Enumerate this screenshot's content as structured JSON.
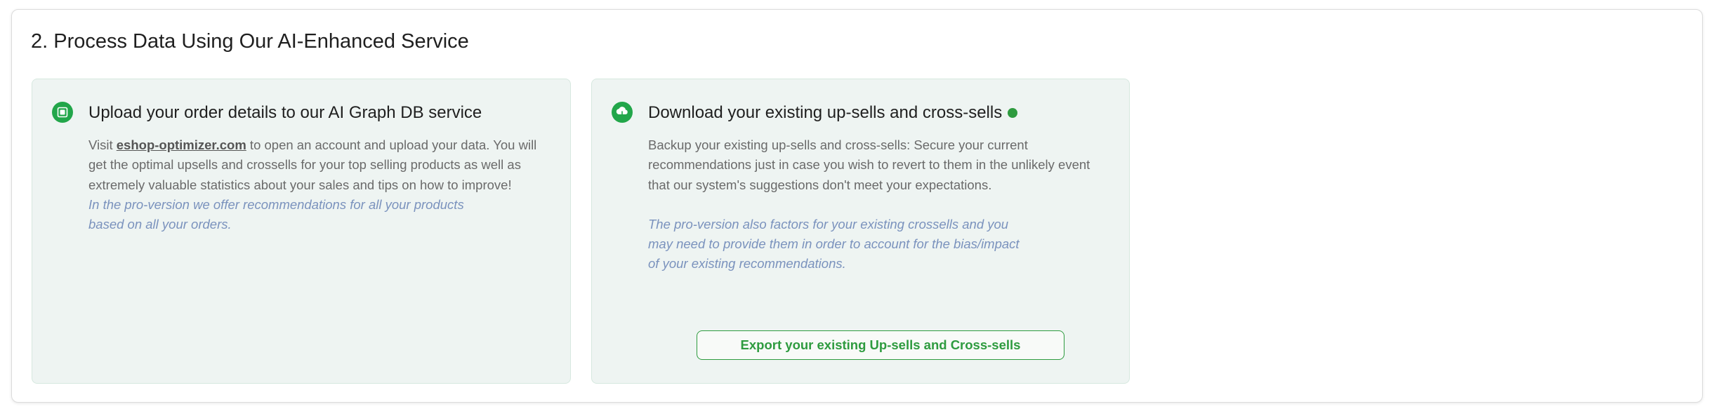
{
  "section": {
    "title": "2. Process Data Using Our AI-Enhanced Service"
  },
  "upload_card": {
    "icon": "chip-icon",
    "title": "Upload your order details to our AI Graph DB service",
    "body_prefix": "Visit ",
    "link_text": "eshop-optimizer.com",
    "body_suffix": " to open an account and upload your data. You will get the optimal upsells and crossells for your top selling products as well as extremely valuable statistics about your sales and tips on how to improve!",
    "pro_note": "In the pro-version we offer recommendations for all your products\nbased on all your orders."
  },
  "download_card": {
    "icon": "cloud-download-icon",
    "title": "Download your existing up-sells and cross-sells",
    "body": "Backup your existing up-sells and cross-sells: Secure your current recommendations just in case you wish to revert to them in the unlikely event that our system's suggestions don't meet your expectations.",
    "pro_note": "The pro-version also factors for your existing crossells and you\nmay need to provide them in order to account for the bias/impact\nof your existing recommendations.",
    "export_button_label": "Export your existing Up-sells and Cross-sells"
  },
  "colors": {
    "accent_green": "#2e9b3f",
    "icon_green": "#22a64a",
    "card_background": "#eef4f2",
    "pro_note_text": "#7a92bd"
  }
}
